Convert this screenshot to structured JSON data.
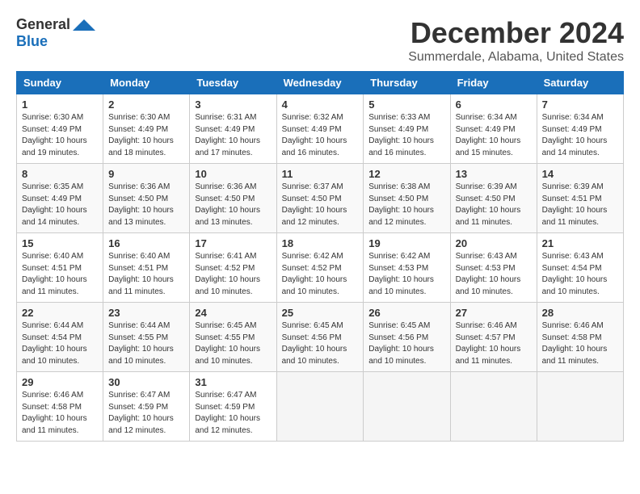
{
  "logo": {
    "general": "General",
    "blue": "Blue"
  },
  "header": {
    "month": "December 2024",
    "location": "Summerdale, Alabama, United States"
  },
  "days_of_week": [
    "Sunday",
    "Monday",
    "Tuesday",
    "Wednesday",
    "Thursday",
    "Friday",
    "Saturday"
  ],
  "weeks": [
    [
      {
        "day": "1",
        "info": "Sunrise: 6:30 AM\nSunset: 4:49 PM\nDaylight: 10 hours\nand 19 minutes."
      },
      {
        "day": "2",
        "info": "Sunrise: 6:30 AM\nSunset: 4:49 PM\nDaylight: 10 hours\nand 18 minutes."
      },
      {
        "day": "3",
        "info": "Sunrise: 6:31 AM\nSunset: 4:49 PM\nDaylight: 10 hours\nand 17 minutes."
      },
      {
        "day": "4",
        "info": "Sunrise: 6:32 AM\nSunset: 4:49 PM\nDaylight: 10 hours\nand 16 minutes."
      },
      {
        "day": "5",
        "info": "Sunrise: 6:33 AM\nSunset: 4:49 PM\nDaylight: 10 hours\nand 16 minutes."
      },
      {
        "day": "6",
        "info": "Sunrise: 6:34 AM\nSunset: 4:49 PM\nDaylight: 10 hours\nand 15 minutes."
      },
      {
        "day": "7",
        "info": "Sunrise: 6:34 AM\nSunset: 4:49 PM\nDaylight: 10 hours\nand 14 minutes."
      }
    ],
    [
      {
        "day": "8",
        "info": "Sunrise: 6:35 AM\nSunset: 4:49 PM\nDaylight: 10 hours\nand 14 minutes."
      },
      {
        "day": "9",
        "info": "Sunrise: 6:36 AM\nSunset: 4:50 PM\nDaylight: 10 hours\nand 13 minutes."
      },
      {
        "day": "10",
        "info": "Sunrise: 6:36 AM\nSunset: 4:50 PM\nDaylight: 10 hours\nand 13 minutes."
      },
      {
        "day": "11",
        "info": "Sunrise: 6:37 AM\nSunset: 4:50 PM\nDaylight: 10 hours\nand 12 minutes."
      },
      {
        "day": "12",
        "info": "Sunrise: 6:38 AM\nSunset: 4:50 PM\nDaylight: 10 hours\nand 12 minutes."
      },
      {
        "day": "13",
        "info": "Sunrise: 6:39 AM\nSunset: 4:50 PM\nDaylight: 10 hours\nand 11 minutes."
      },
      {
        "day": "14",
        "info": "Sunrise: 6:39 AM\nSunset: 4:51 PM\nDaylight: 10 hours\nand 11 minutes."
      }
    ],
    [
      {
        "day": "15",
        "info": "Sunrise: 6:40 AM\nSunset: 4:51 PM\nDaylight: 10 hours\nand 11 minutes."
      },
      {
        "day": "16",
        "info": "Sunrise: 6:40 AM\nSunset: 4:51 PM\nDaylight: 10 hours\nand 11 minutes."
      },
      {
        "day": "17",
        "info": "Sunrise: 6:41 AM\nSunset: 4:52 PM\nDaylight: 10 hours\nand 10 minutes."
      },
      {
        "day": "18",
        "info": "Sunrise: 6:42 AM\nSunset: 4:52 PM\nDaylight: 10 hours\nand 10 minutes."
      },
      {
        "day": "19",
        "info": "Sunrise: 6:42 AM\nSunset: 4:53 PM\nDaylight: 10 hours\nand 10 minutes."
      },
      {
        "day": "20",
        "info": "Sunrise: 6:43 AM\nSunset: 4:53 PM\nDaylight: 10 hours\nand 10 minutes."
      },
      {
        "day": "21",
        "info": "Sunrise: 6:43 AM\nSunset: 4:54 PM\nDaylight: 10 hours\nand 10 minutes."
      }
    ],
    [
      {
        "day": "22",
        "info": "Sunrise: 6:44 AM\nSunset: 4:54 PM\nDaylight: 10 hours\nand 10 minutes."
      },
      {
        "day": "23",
        "info": "Sunrise: 6:44 AM\nSunset: 4:55 PM\nDaylight: 10 hours\nand 10 minutes."
      },
      {
        "day": "24",
        "info": "Sunrise: 6:45 AM\nSunset: 4:55 PM\nDaylight: 10 hours\nand 10 minutes."
      },
      {
        "day": "25",
        "info": "Sunrise: 6:45 AM\nSunset: 4:56 PM\nDaylight: 10 hours\nand 10 minutes."
      },
      {
        "day": "26",
        "info": "Sunrise: 6:45 AM\nSunset: 4:56 PM\nDaylight: 10 hours\nand 10 minutes."
      },
      {
        "day": "27",
        "info": "Sunrise: 6:46 AM\nSunset: 4:57 PM\nDaylight: 10 hours\nand 11 minutes."
      },
      {
        "day": "28",
        "info": "Sunrise: 6:46 AM\nSunset: 4:58 PM\nDaylight: 10 hours\nand 11 minutes."
      }
    ],
    [
      {
        "day": "29",
        "info": "Sunrise: 6:46 AM\nSunset: 4:58 PM\nDaylight: 10 hours\nand 11 minutes."
      },
      {
        "day": "30",
        "info": "Sunrise: 6:47 AM\nSunset: 4:59 PM\nDaylight: 10 hours\nand 12 minutes."
      },
      {
        "day": "31",
        "info": "Sunrise: 6:47 AM\nSunset: 4:59 PM\nDaylight: 10 hours\nand 12 minutes."
      },
      {
        "day": "",
        "info": ""
      },
      {
        "day": "",
        "info": ""
      },
      {
        "day": "",
        "info": ""
      },
      {
        "day": "",
        "info": ""
      }
    ]
  ]
}
